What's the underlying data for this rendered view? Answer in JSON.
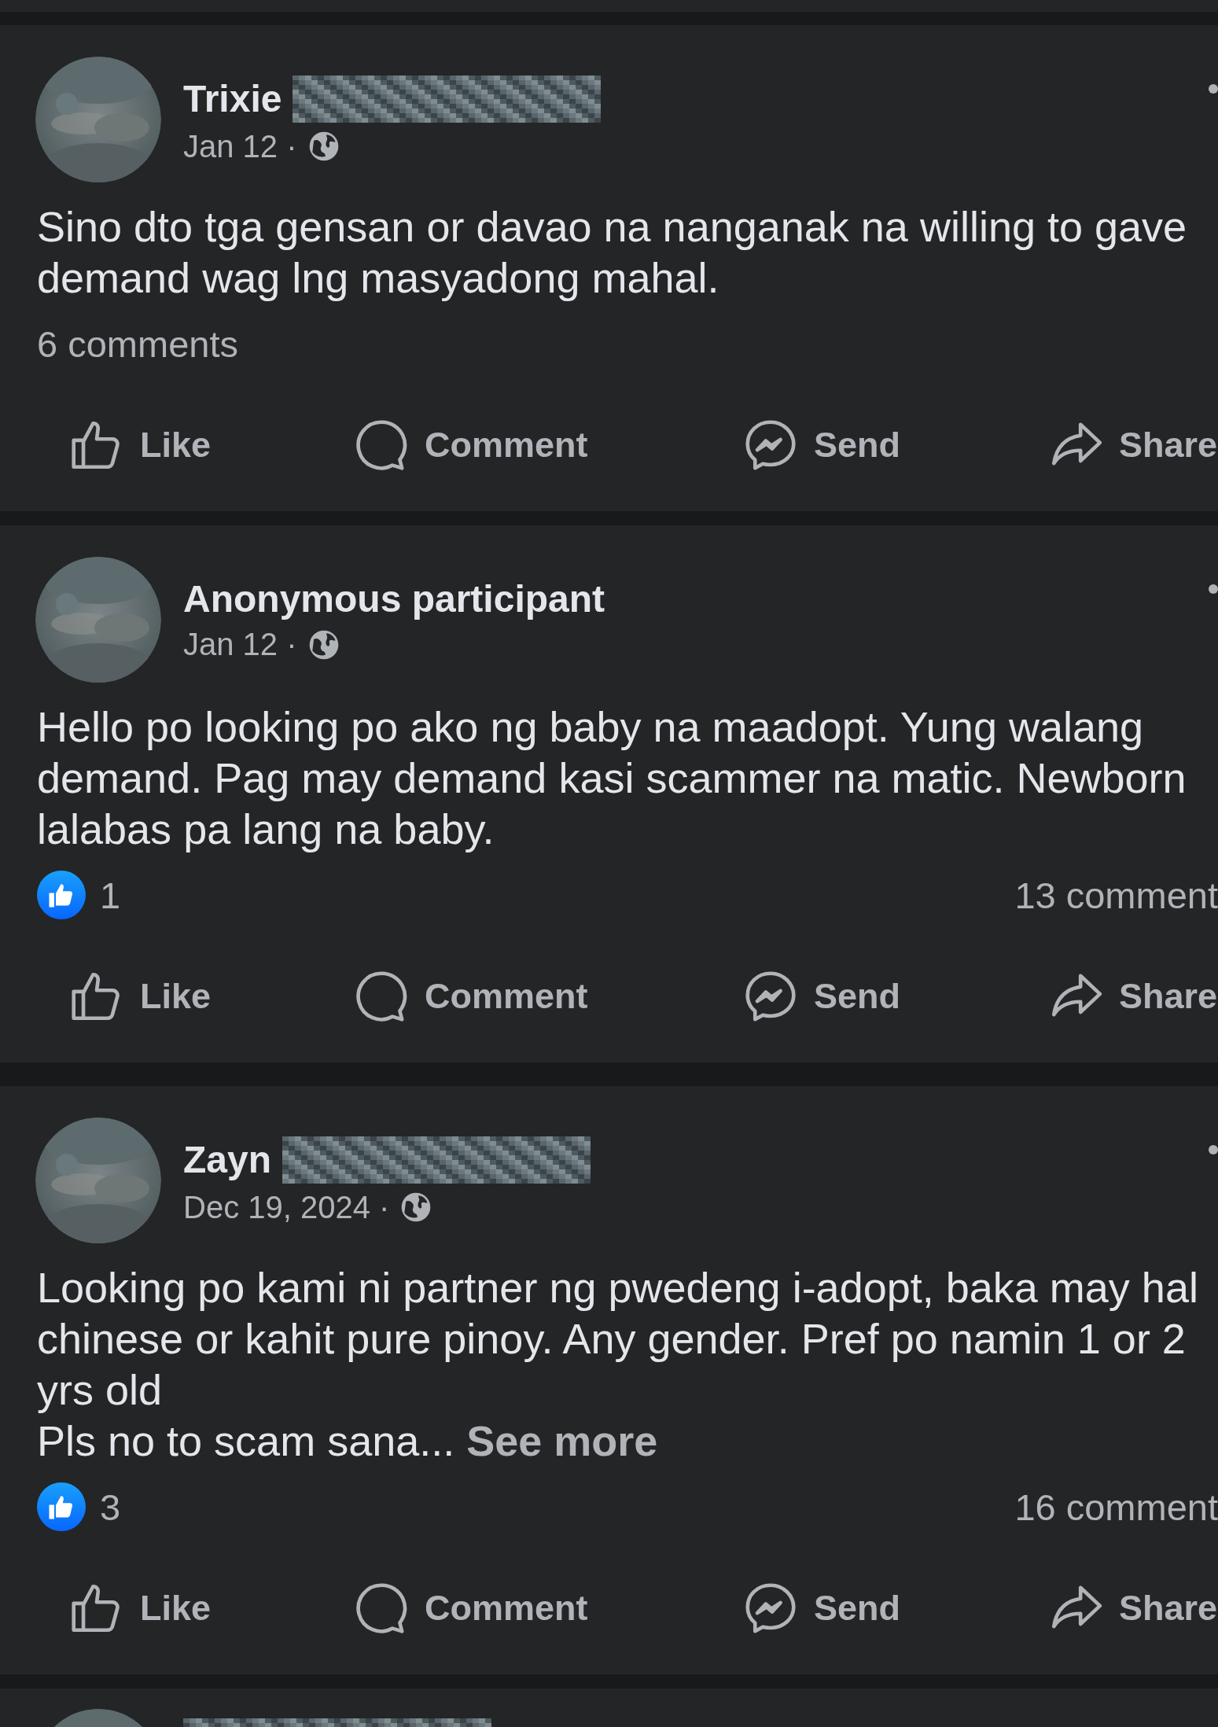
{
  "posts": [
    {
      "author": {
        "name": "Trixie",
        "redacted": true
      },
      "date": "Jan 12 ·",
      "text_lines": [
        "Sino dto tga gensan or davao na nanganak na willing to gave",
        "demand wag lng masyadong mahal."
      ],
      "comments": "6 comments",
      "actions": [
        {
          "label": "Like",
          "kind": "like"
        },
        {
          "label": "Comment",
          "kind": "comment"
        },
        {
          "label": "Send",
          "kind": "send"
        },
        {
          "label": "Share",
          "kind": "share"
        }
      ]
    },
    {
      "author": {
        "name": "Anonymous participant",
        "redacted": false
      },
      "date": "Jan 12 ·",
      "text_lines": [
        "Hello po looking po ako ng baby na maadopt. Yung walang",
        "demand. Pag may demand kasi scammer na matic. Newborn",
        "lalabas pa lang na baby."
      ],
      "reactions": "1",
      "comments": "13 comment",
      "actions": [
        {
          "label": "Like",
          "kind": "like"
        },
        {
          "label": "Comment",
          "kind": "comment"
        },
        {
          "label": "Send",
          "kind": "send"
        },
        {
          "label": "Share",
          "kind": "share"
        }
      ]
    },
    {
      "author": {
        "name": "Zayn",
        "redacted": true
      },
      "date": "Dec 19, 2024 ·",
      "text_lines": [
        "Looking po kami ni partner ng pwedeng i-adopt, baka may hal",
        "chinese or kahit pure pinoy. Any gender. Pref po namin 1 or 2",
        "yrs old",
        "Pls no to scam sana..."
      ],
      "see_more": "See more",
      "reactions": "3",
      "comments": "16 comment",
      "actions": [
        {
          "label": "Like",
          "kind": "like"
        },
        {
          "label": "Comment",
          "kind": "comment"
        },
        {
          "label": "Send",
          "kind": "send"
        },
        {
          "label": "Share",
          "kind": "share"
        }
      ]
    },
    {
      "author": {
        "redacted": true
      }
    }
  ]
}
